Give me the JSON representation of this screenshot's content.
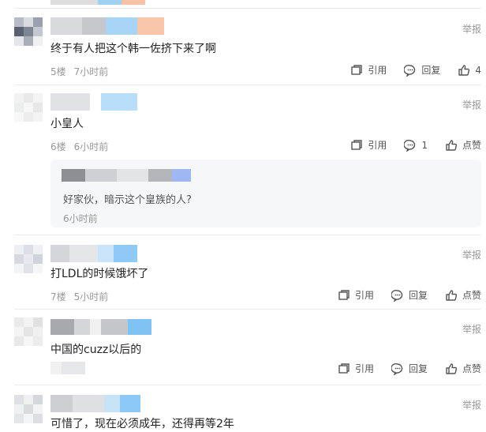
{
  "report_label": "举报",
  "action_quote": "引用",
  "action_reply": "回复",
  "action_like": "点赞",
  "comments": [
    {
      "text": "",
      "floor": "",
      "time": "",
      "reply_count": "",
      "like_count": ""
    },
    {
      "text": "终于有人把这个韩一佐挤下来了啊",
      "floor": "5楼",
      "time": "7小时前",
      "reply_label": "回复",
      "like_label": "4"
    },
    {
      "text": "小皇人",
      "floor": "6楼",
      "time": "6小时前",
      "reply_label": "1",
      "like_label": "点赞",
      "reply": {
        "text": "好家伙，暗示这个皇族的人?",
        "time": "6小时前"
      }
    },
    {
      "text": "打LDL的时候饿坏了",
      "floor": "7楼",
      "time": "5小时前",
      "reply_label": "回复",
      "like_label": "点赞"
    },
    {
      "text": "中国的cuzz以后的",
      "floor": "",
      "time": "",
      "reply_label": "回复",
      "like_label": "点赞"
    },
    {
      "text": "可惜了，现在必须成年，还得再等2年",
      "floor": "",
      "time": "",
      "reply_label": "",
      "like_label": ""
    }
  ]
}
